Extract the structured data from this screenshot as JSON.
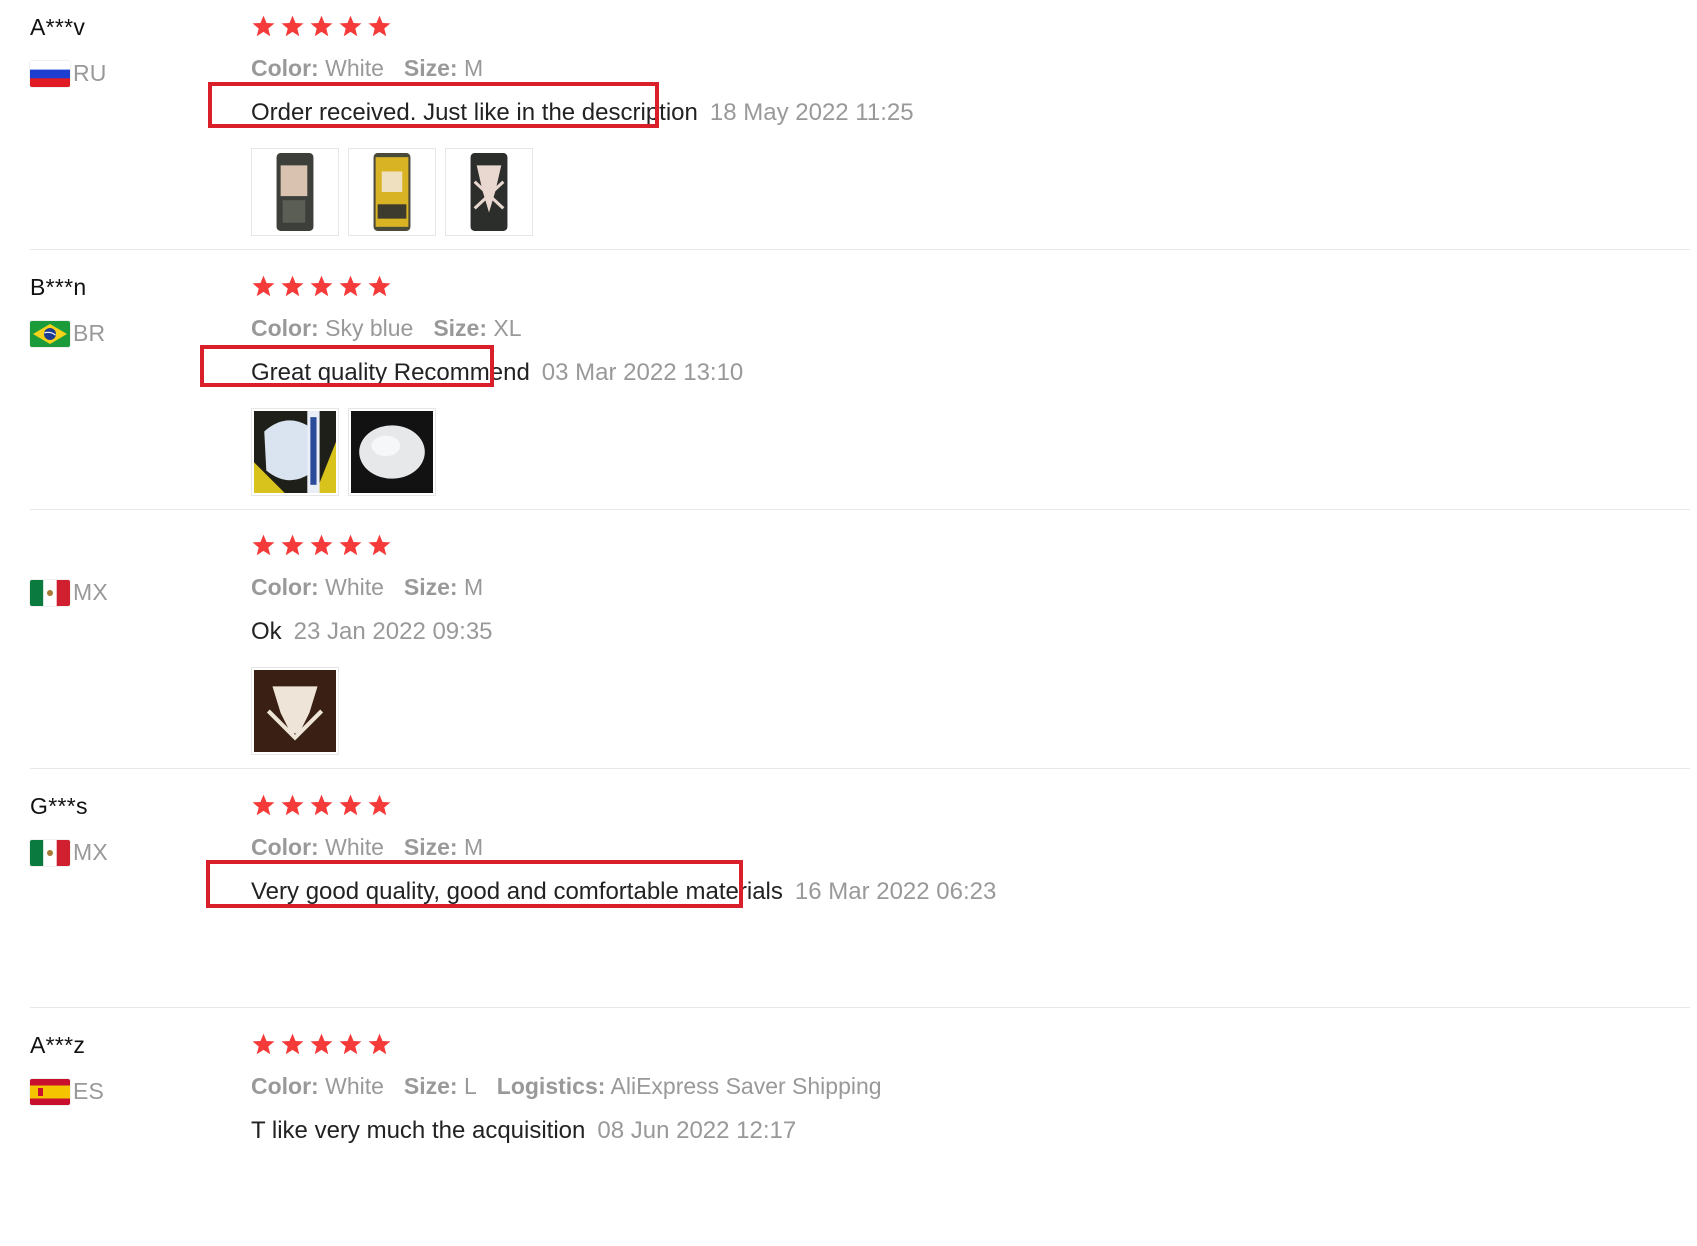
{
  "reviews": [
    {
      "user": "A***v",
      "country": "RU",
      "rating": 5,
      "attrs": [
        {
          "label": "Color:",
          "value": "White"
        },
        {
          "label": "Size:",
          "value": "M"
        }
      ],
      "feedback": "Order received. Just like in the description",
      "date": "18 May 2022 11:25",
      "photos": [
        "package-photo",
        "package-photo",
        "product-photo"
      ],
      "highlighted": true
    },
    {
      "user": "B***n",
      "country": "BR",
      "rating": 5,
      "attrs": [
        {
          "label": "Color:",
          "value": "Sky blue"
        },
        {
          "label": "Size:",
          "value": "XL"
        }
      ],
      "feedback": "Great quality Recommend",
      "date": "03 Mar 2022 13:10",
      "photos": [
        "product-photo",
        "product-photo"
      ],
      "highlighted": true
    },
    {
      "user": "",
      "country": "MX",
      "rating": 5,
      "attrs": [
        {
          "label": "Color:",
          "value": "White"
        },
        {
          "label": "Size:",
          "value": "M"
        }
      ],
      "feedback": "Ok",
      "date": "23 Jan 2022 09:35",
      "photos": [
        "product-photo"
      ],
      "highlighted": false
    },
    {
      "user": "G***s",
      "country": "MX",
      "rating": 5,
      "attrs": [
        {
          "label": "Color:",
          "value": "White"
        },
        {
          "label": "Size:",
          "value": "M"
        }
      ],
      "feedback": "Very good quality, good and comfortable materials",
      "date": "16 Mar 2022 06:23",
      "photos": [],
      "highlighted": true
    },
    {
      "user": "A***z",
      "country": "ES",
      "rating": 5,
      "attrs": [
        {
          "label": "Color:",
          "value": "White"
        },
        {
          "label": "Size:",
          "value": "L"
        },
        {
          "label": "Logistics:",
          "value": "AliExpress Saver Shipping"
        }
      ],
      "feedback": "T like very much the acquisition",
      "date": "08 Jun 2022 12:17",
      "photos": [],
      "highlighted": false
    }
  ],
  "colors": {
    "star": "#f53a3a",
    "highlight": "#d9202a",
    "muted_text": "#999999",
    "body_text": "#222222"
  }
}
